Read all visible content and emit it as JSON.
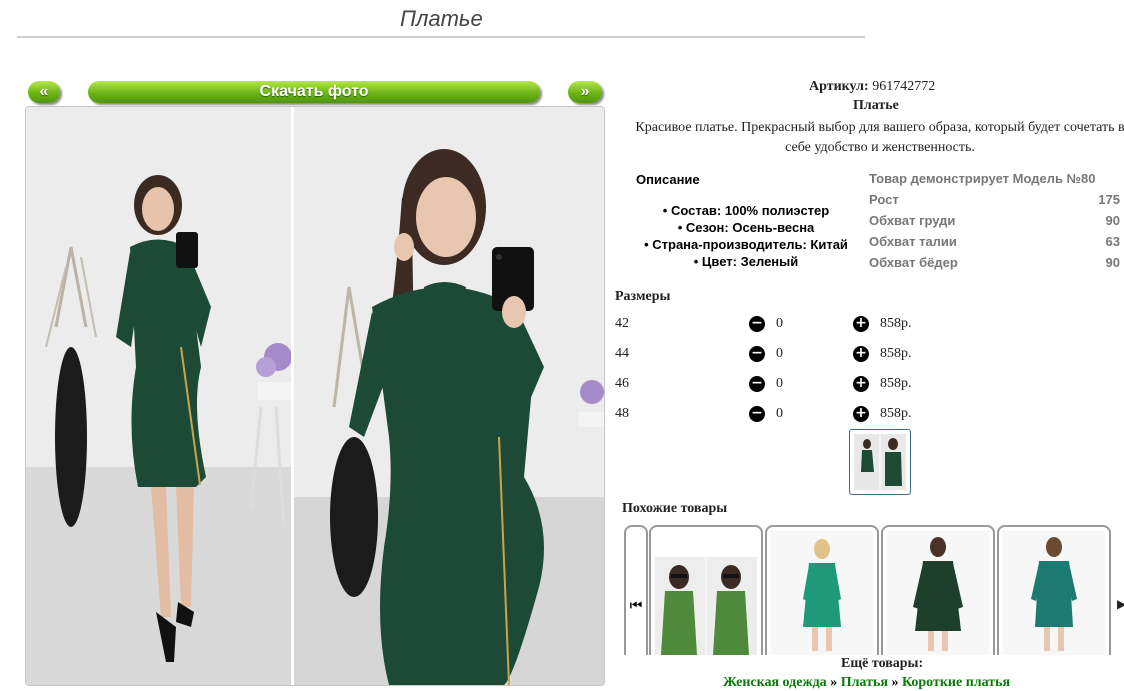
{
  "page": {
    "title": "Платье"
  },
  "gallery": {
    "prev_label": "«",
    "next_label": "»",
    "download_label": "Скачать фото"
  },
  "product": {
    "article_label": "Артикул:",
    "article_value": "961742772",
    "name": "Платье",
    "description": "Красивое платье. Прекрасный выбор для вашего образа, который будет сочетать в себе удобство и женственность."
  },
  "details": {
    "heading": "Описание",
    "items": [
      "Состав: 100% полиэстер",
      "Сезон: Осень-весна",
      "Страна-производитель: Китай",
      "Цвет: Зеленый"
    ]
  },
  "model": {
    "heading": "Товар демонстрирует Модель №80",
    "rows": [
      {
        "label": "Рост",
        "value": "175"
      },
      {
        "label": "Обхват груди",
        "value": "90"
      },
      {
        "label": "Обхват талии",
        "value": "63"
      },
      {
        "label": "Обхват бёдер",
        "value": "90"
      }
    ]
  },
  "sizes": {
    "heading": "Размеры",
    "rows": [
      {
        "size": "42",
        "qty": "0",
        "price": "858р."
      },
      {
        "size": "44",
        "qty": "0",
        "price": "858р."
      },
      {
        "size": "46",
        "qty": "0",
        "price": "858р."
      },
      {
        "size": "48",
        "qty": "0",
        "price": "858р."
      }
    ]
  },
  "similar": {
    "heading": "Похожие товары"
  },
  "more": {
    "label": "Ещё товары:",
    "crumbs": [
      "Женская одежда",
      "Платья",
      "Короткие платья"
    ],
    "separator": "»"
  },
  "colors": {
    "accent_green": "#6db515",
    "link_green": "#0a7a0a",
    "dress_green": "#1d4a36"
  }
}
